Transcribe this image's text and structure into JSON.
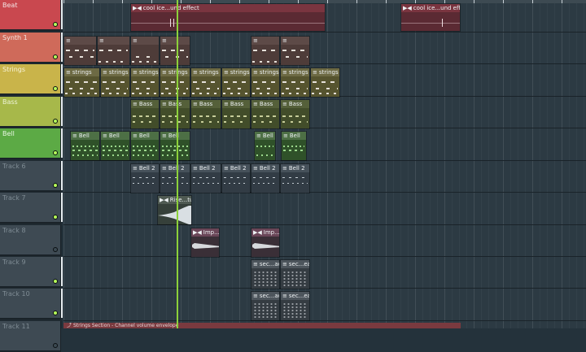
{
  "tracks": [
    {
      "name": "Beat",
      "color": "#c9484f",
      "text_color": "#f3e4e4",
      "active": true
    },
    {
      "name": "Synth 1",
      "color": "#cf6a5a",
      "text_color": "#f6e7e2",
      "active": true
    },
    {
      "name": "Strings",
      "color": "#c9b44a",
      "text_color": "#f8f3d8",
      "active": true
    },
    {
      "name": "Bass",
      "color": "#a7b84a",
      "text_color": "#eef3d6",
      "active": true
    },
    {
      "name": "Bell",
      "color": "#5caa45",
      "text_color": "#e8f6e3",
      "active": true
    },
    {
      "name": "Track 6",
      "color": "#3e4a53",
      "text_color": "#7f8c94",
      "active": true
    },
    {
      "name": "Track 7",
      "color": "#3e4a53",
      "text_color": "#7f8c94",
      "active": true
    },
    {
      "name": "Track 8",
      "color": "#3e4a53",
      "text_color": "#7f8c94",
      "active": false
    },
    {
      "name": "Track 9",
      "color": "#3e4a53",
      "text_color": "#7f8c94",
      "active": true
    },
    {
      "name": "Track 10",
      "color": "#3e4a53",
      "text_color": "#7f8c94",
      "active": true
    },
    {
      "name": "Track 11",
      "color": "#3e4a53",
      "text_color": "#7f8c94",
      "active": false
    }
  ],
  "clips": {
    "beat": [
      "cool ice...und effect",
      "cool ice...und effect"
    ],
    "synth": [
      "",
      "",
      "",
      "",
      "",
      ""
    ],
    "strings": [
      "strings",
      "strings",
      "strings",
      "strings",
      "strings",
      "strings",
      "strings",
      "strings",
      "strings"
    ],
    "bass": [
      "Bass",
      "Bass",
      "Bass",
      "Bass",
      "Bass",
      "Bass"
    ],
    "bell": [
      "Bell",
      "Bell",
      "Bell",
      "Bell",
      "Bell",
      "Bell"
    ],
    "bell2": [
      "Bell 2",
      "Bell 2",
      "Bell 2",
      "Bell 2",
      "Bell 2",
      "Bell 2"
    ],
    "rise": [
      "Rise...ture"
    ],
    "imp": [
      "Imp...le",
      "Imp...le"
    ],
    "sec": [
      "sec...ad",
      "sec...ead",
      "sec...ad",
      "sec...ead"
    ]
  },
  "envelope_label": "Strings Section - Channel volume envelope",
  "icons": {
    "pattern": "pattern-icon",
    "audio": "audio-clip-icon"
  },
  "colors": {
    "playhead": "#8cd13a",
    "background": "#24323b"
  }
}
